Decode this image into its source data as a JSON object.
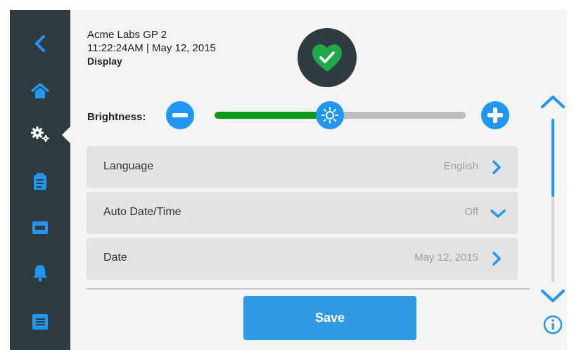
{
  "header": {
    "device_name": "Acme Labs GP 2",
    "datetime": "11:22:24AM | May 12, 2015",
    "page_title": "Display"
  },
  "status": {
    "state": "ok",
    "icon": "heart-check-icon",
    "color": "#21a84a"
  },
  "sidebar": {
    "items": [
      {
        "name": "back",
        "icon": "chevron-left-icon"
      },
      {
        "name": "home",
        "icon": "home-icon"
      },
      {
        "name": "settings",
        "icon": "gears-icon",
        "active": true
      },
      {
        "name": "clipboard",
        "icon": "clipboard-icon"
      },
      {
        "name": "panel",
        "icon": "panel-icon"
      },
      {
        "name": "alerts",
        "icon": "bell-icon"
      },
      {
        "name": "list",
        "icon": "list-icon"
      }
    ]
  },
  "brightness": {
    "label": "Brightness:",
    "level": 0.46
  },
  "rows": [
    {
      "label": "Language",
      "value": "English",
      "chevron": "right"
    },
    {
      "label": "Auto Date/Time",
      "value": "Off",
      "chevron": "down"
    },
    {
      "label": "Date",
      "value": "May 12, 2015",
      "chevron": "right"
    }
  ],
  "actions": {
    "save_label": "Save"
  },
  "scroll": {
    "position": 0.0,
    "visible_fraction": 0.48
  },
  "colors": {
    "accent": "#2196f3",
    "sidebar": "#2f3b40",
    "slider_fill": "#0a9a1c"
  }
}
